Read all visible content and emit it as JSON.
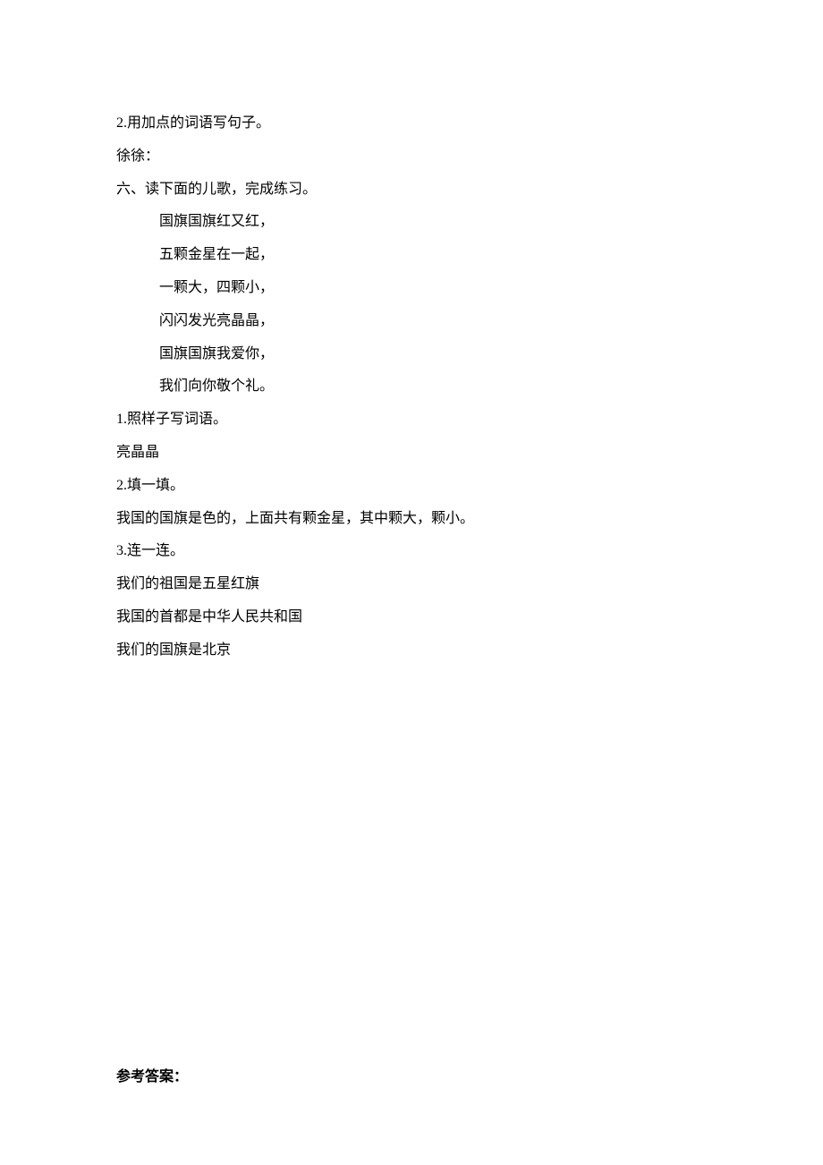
{
  "lines": {
    "l1": "2.用加点的词语写句子。",
    "l2": "徐徐：",
    "l3": "六、读下面的儿歌，完成练习。",
    "l4": "国旗国旗红又红，",
    "l5": "五颗金星在一起，",
    "l6": "一颗大，四颗小，",
    "l7": "闪闪发光亮晶晶，",
    "l8": "国旗国旗我爱你，",
    "l9": "我们向你敬个礼。",
    "l10": "1.照样子写词语。",
    "l11": "亮晶晶",
    "l12": "2.填一填。",
    "l13": "我国的国旗是色的，上面共有颗金星，其中颗大，颗小。",
    "l14": "3.连一连。",
    "l15": "我们的祖国是五星红旗",
    "l16": "我国的首都是中华人民共和国",
    "l17": "我们的国旗是北京",
    "l18": "参考答案："
  }
}
